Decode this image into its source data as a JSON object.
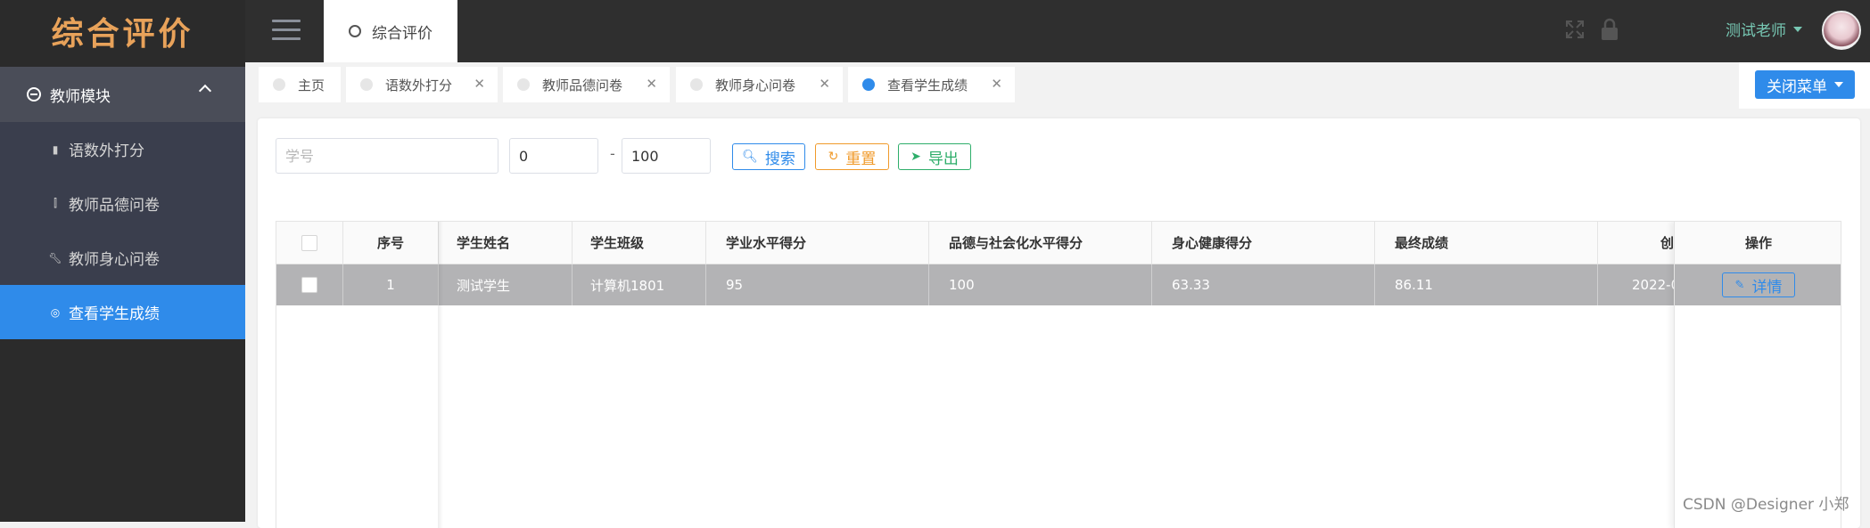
{
  "app": {
    "logo_text": "综合评价"
  },
  "sidebar": {
    "group_label": "教师模块",
    "items": [
      {
        "label": "语数外打分",
        "icon": "document-icon"
      },
      {
        "label": "教师品德问卷",
        "icon": "dumbbell-icon"
      },
      {
        "label": "教师身心问卷",
        "icon": "wrench-icon"
      },
      {
        "label": "查看学生成绩",
        "icon": "target-icon",
        "active": true
      }
    ]
  },
  "header": {
    "top_tab_label": "综合评价",
    "user_name": "测试老师"
  },
  "tabs": [
    {
      "label": "主页",
      "closable": false
    },
    {
      "label": "语数外打分",
      "closable": true
    },
    {
      "label": "教师品德问卷",
      "closable": true
    },
    {
      "label": "教师身心问卷",
      "closable": true
    },
    {
      "label": "查看学生成绩",
      "closable": true,
      "active": true
    }
  ],
  "close_menu_label": "关闭菜单",
  "filters": {
    "student_id_placeholder": "学号",
    "range_min": "0",
    "range_separator": "-",
    "range_max": "100",
    "search_label": "搜索",
    "reset_label": "重置",
    "export_label": "导出"
  },
  "table": {
    "columns": [
      "序号",
      "学生姓名",
      "学生班级",
      "学业水平得分",
      "品德与社会化水平得分",
      "身心健康得分",
      "最终成绩",
      "创"
    ],
    "action_column": "操作",
    "rows": [
      {
        "index": "1",
        "name": "测试学生",
        "class": "计算机1801",
        "academic": "95",
        "moral": "100",
        "health": "63.33",
        "final": "86.11",
        "created": "2022-0"
      }
    ],
    "detail_label": "详情"
  },
  "watermark": "CSDN @Designer 小郑",
  "colors": {
    "primary": "#2f8bea",
    "warning": "#f09a2a",
    "success": "#2eae6a",
    "sidebar": "#2b2b2b",
    "active_row": "#b3b3b5"
  }
}
